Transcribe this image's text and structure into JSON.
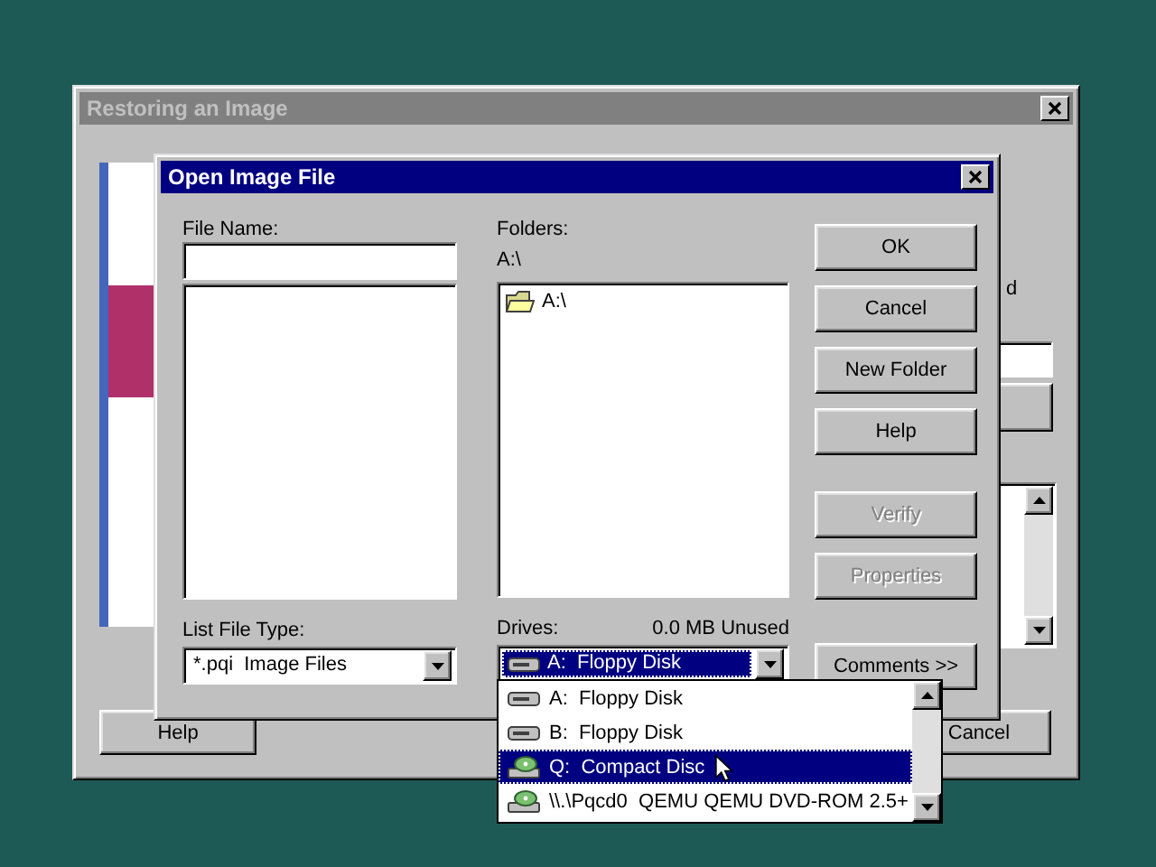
{
  "back_window": {
    "title": "Restoring an Image",
    "active": false,
    "partial_text": "d",
    "buttons": [
      {
        "label": "Help"
      },
      {
        "label": "Cancel"
      }
    ]
  },
  "dialog": {
    "title": "Open Image File",
    "active": true,
    "file_name": {
      "label": "File Name:"
    },
    "folders": {
      "label": "Folders:",
      "path": "A:\\",
      "items": [
        {
          "name": "A:\\",
          "kind": "folder"
        }
      ]
    },
    "list_file_type": {
      "label": "List File Type:",
      "value": "*.pqi  Image Files"
    },
    "drives": {
      "label": "Drives:",
      "free": "0.0 MB Unused",
      "value": {
        "label": "A:  Floppy Disk",
        "kind": "floppy"
      },
      "expanded": true,
      "options": [
        {
          "label": "A:  Floppy Disk",
          "kind": "floppy",
          "selected": false
        },
        {
          "label": "B:  Floppy Disk",
          "kind": "floppy",
          "selected": false
        },
        {
          "label": "Q:  Compact Disc",
          "kind": "cd",
          "selected": true
        },
        {
          "label": "\\\\.\\Pqcd0  QEMU QEMU DVD-ROM 2.5+",
          "kind": "cd",
          "selected": false
        }
      ]
    },
    "buttons": [
      {
        "label": "OK",
        "disabled": false
      },
      {
        "label": "Cancel",
        "disabled": false
      },
      {
        "label": "New Folder",
        "disabled": false
      },
      {
        "label": "Help",
        "disabled": false
      },
      {
        "label": "Verify",
        "disabled": true
      },
      {
        "label": "Properties",
        "disabled": true
      },
      {
        "label": "Comments >>",
        "disabled": false
      }
    ]
  }
}
